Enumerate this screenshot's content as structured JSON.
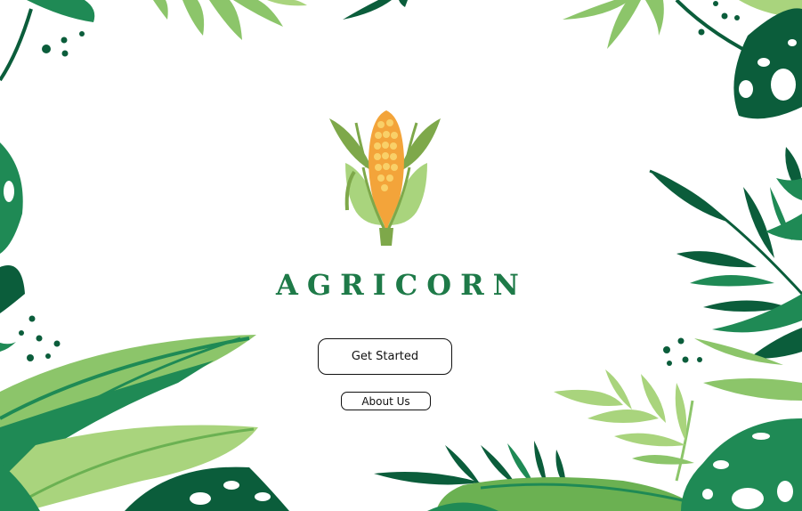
{
  "app": {
    "brand_name": "AGRICORN"
  },
  "actions": {
    "get_started_label": "Get Started",
    "about_us_label": "About Us"
  },
  "icons": {
    "logo": "corn-icon",
    "decoration": "tropical-leaves"
  },
  "colors": {
    "brand_text": "#1e7a48",
    "leaf_dark": "#0b5d3b",
    "leaf_mid": "#1f8a55",
    "leaf_light": "#8cc56a",
    "leaf_pale": "#a9d47d",
    "corn_kernel": "#f3a43a",
    "corn_highlight": "#f9d068",
    "background": "#ffffff"
  }
}
